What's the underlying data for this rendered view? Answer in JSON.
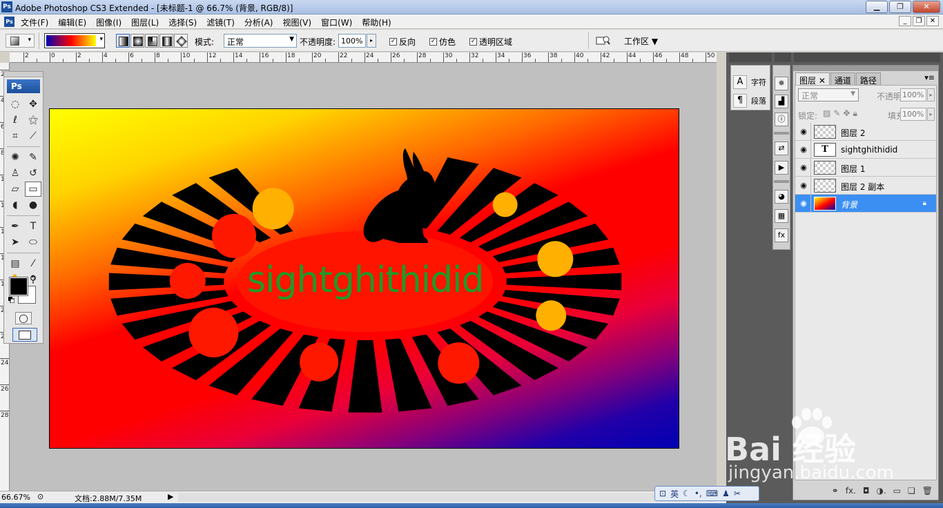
{
  "window": {
    "title": "Adobe Photoshop CS3 Extended - [未标题-1 @ 66.7% (背景, RGB/8)]",
    "app_icon": "Ps",
    "controls": [
      "minimize-icon",
      "maximize-icon",
      "close-icon"
    ]
  },
  "menubar": {
    "items": [
      "文件(F)",
      "编辑(E)",
      "图像(I)",
      "图层(L)",
      "选择(S)",
      "滤镜(T)",
      "分析(A)",
      "视图(V)",
      "窗口(W)",
      "帮助(H)"
    ]
  },
  "options": {
    "mode_label": "模式:",
    "mode_value": "正常",
    "opacity_label": "不透明度:",
    "opacity_value": "100%",
    "reverse_label": "反向",
    "dither_label": "仿色",
    "transparency_label": "透明区域",
    "workspace_label": "工作区 ▼",
    "gradient_colors": [
      "#0000b4",
      "#ff0000",
      "#ffff00"
    ]
  },
  "rulers": {
    "top": [
      "2",
      "0",
      "2",
      "4",
      "6",
      "8",
      "10",
      "12",
      "14",
      "16",
      "18",
      "20",
      "22",
      "24",
      "26",
      "28",
      "30",
      "32",
      "34",
      "36",
      "38",
      "40",
      "42",
      "44",
      "46",
      "48",
      "50"
    ],
    "left": [
      "2",
      "4",
      "6",
      "8",
      "10",
      "12",
      "14",
      "16",
      "18",
      "20",
      "22",
      "24",
      "26",
      "28"
    ]
  },
  "toolbox": {
    "logo": "Ps",
    "foreground_color": "#000000",
    "background_color": "#ffffff"
  },
  "document": {
    "text_layer_content": "sightghithidid",
    "text_color": "#1e9a28"
  },
  "status": {
    "zoom": "66.67%",
    "doc_info": "文档:2.88M/7.35M"
  },
  "char_panel": {
    "character_label": "字符",
    "paragraph_label": "段落"
  },
  "layers_panel": {
    "tabs": [
      "图层",
      "通道",
      "路径"
    ],
    "blend_mode": "正常",
    "opacity_label": "不透明度:",
    "opacity_value": "100%",
    "lock_label": "锁定:",
    "fill_label": "填充:",
    "fill_value": "100%",
    "layers": [
      {
        "name": "图层 2",
        "type": "pixel",
        "selected": false
      },
      {
        "name": "sightghithidid",
        "type": "text",
        "selected": false
      },
      {
        "name": "图层 1",
        "type": "pixel",
        "selected": false
      },
      {
        "name": "图层 2 副本",
        "type": "pixel",
        "selected": false
      },
      {
        "name": "背景",
        "type": "background",
        "selected": true
      }
    ]
  },
  "ime": {
    "lang": "英"
  },
  "watermark": {
    "brand": "Bai 经验",
    "url": "jingyan.baidu.com"
  }
}
